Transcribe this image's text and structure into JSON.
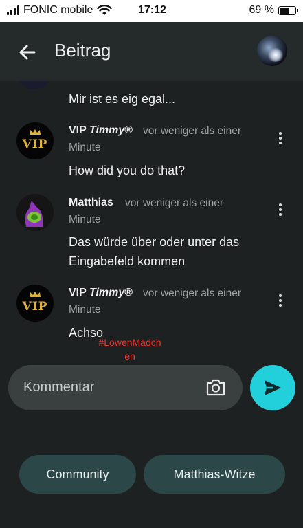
{
  "status_bar": {
    "carrier": "FONIC mobile",
    "time": "17:12",
    "battery": "69 %",
    "battery_level": 0.69
  },
  "header": {
    "title": "Beitrag"
  },
  "comments": [
    {
      "text": "Mir ist es eig egal..."
    },
    {
      "author_prefix": "VIP",
      "author_name": "Timmy",
      "author_suffix": "®",
      "time_line1": "vor weniger als einer",
      "time_line2": "Minute",
      "text": "How did you do that?",
      "avatar_text": "VIP"
    },
    {
      "author_prefix": "Matthias",
      "time_line1": "vor weniger als einer",
      "time_line2": "Minute",
      "text_line1": "Das würde über oder unter das",
      "text_line2": "Eingabefeld kommen"
    },
    {
      "author_prefix": "VIP",
      "author_name": "Timmy",
      "author_suffix": "®",
      "time_line1": "vor weniger als einer",
      "time_line2": "Minute",
      "text": "Achso",
      "avatar_text": "VIP"
    }
  ],
  "hashtag": {
    "line1": "#LöwenMädch",
    "line2": "en"
  },
  "input": {
    "placeholder": "Kommentar"
  },
  "chips": [
    {
      "label": "Community"
    },
    {
      "label": "Matthias-Witze"
    }
  ],
  "colors": {
    "background": "#1e2121",
    "header": "#252a2a",
    "accent": "#22d0dc",
    "chip": "#2c4748",
    "hashtag": "#e53935"
  }
}
